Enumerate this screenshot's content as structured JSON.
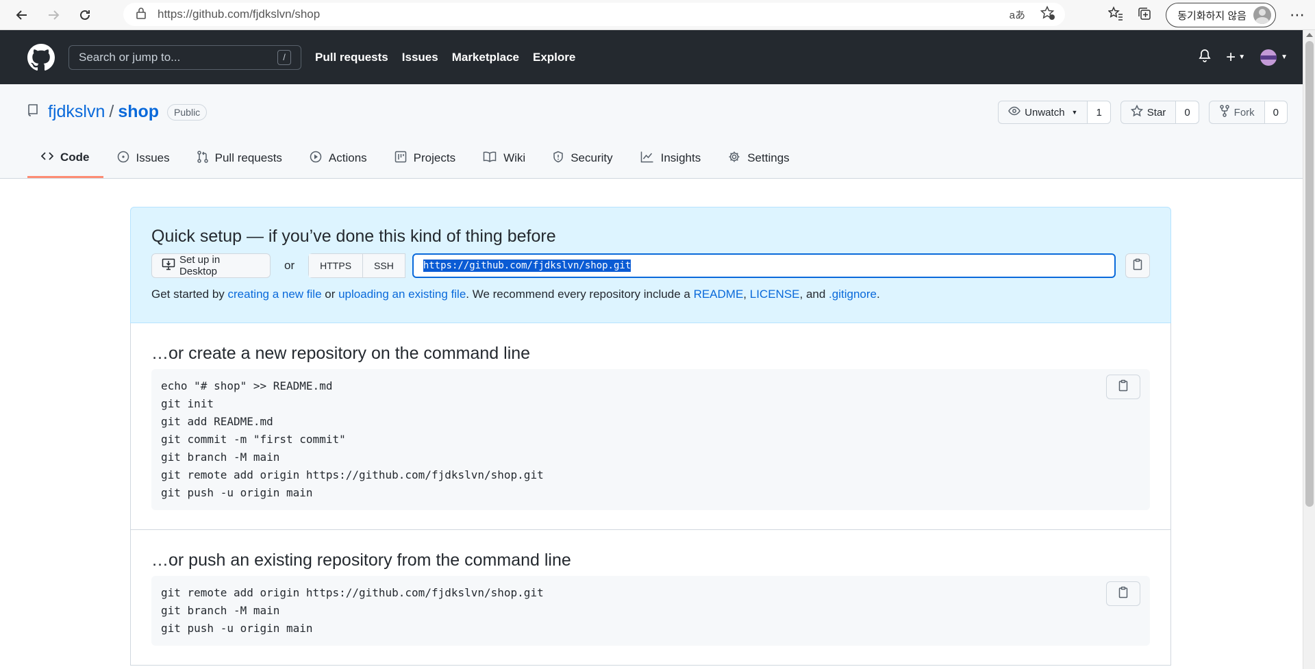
{
  "browser": {
    "url_prefix": "https://",
    "url_host": "github.com",
    "url_path": "/fjdkslvn/shop",
    "sync_label": "동기화하지 않음",
    "translate_glyph": "aあ"
  },
  "gh_header": {
    "search_placeholder": "Search or jump to...",
    "search_shortcut": "/",
    "nav": [
      "Pull requests",
      "Issues",
      "Marketplace",
      "Explore"
    ],
    "plus": "+"
  },
  "repo": {
    "owner": "fjdkslvn",
    "separator": "/",
    "name": "shop",
    "visibility": "Public",
    "watch_label": "Unwatch",
    "watch_count": "1",
    "star_label": "Star",
    "star_count": "0",
    "fork_label": "Fork",
    "fork_count": "0",
    "tabs": [
      "Code",
      "Issues",
      "Pull requests",
      "Actions",
      "Projects",
      "Wiki",
      "Security",
      "Insights",
      "Settings"
    ]
  },
  "quick_setup": {
    "title": "Quick setup — if you’ve done this kind of thing before",
    "desktop_button": "Set up in Desktop",
    "or_text": "or",
    "https_label": "HTTPS",
    "ssh_label": "SSH",
    "clone_url": "https://github.com/fjdkslvn/shop.git",
    "help_prefix": "Get started by ",
    "help_link_new_file": "creating a new file",
    "help_or": " or ",
    "help_link_upload": "uploading an existing file",
    "help_middle": ". We recommend every repository include a ",
    "help_link_readme": "README",
    "help_comma": ", ",
    "help_link_license": "LICENSE",
    "help_and": ", and ",
    "help_link_gitignore": ".gitignore",
    "help_end": "."
  },
  "new_repo": {
    "title": "…or create a new repository on the command line",
    "lines": [
      "echo \"# shop\" >> README.md",
      "git init",
      "git add README.md",
      "git commit -m \"first commit\"",
      "git branch -M main",
      "git remote add origin https://github.com/fjdkslvn/shop.git",
      "git push -u origin main"
    ]
  },
  "push_repo": {
    "title": "…or push an existing repository from the command line",
    "lines": [
      "git remote add origin https://github.com/fjdkslvn/shop.git",
      "git branch -M main",
      "git push -u origin main"
    ]
  }
}
